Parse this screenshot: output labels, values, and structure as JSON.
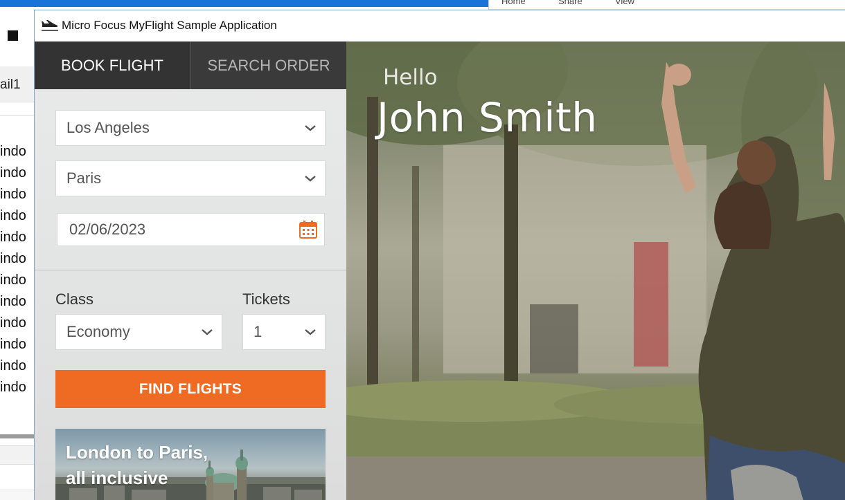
{
  "background": {
    "ribbon_tabs": [
      "Home",
      "Share",
      "View"
    ],
    "sidebar_folder": "ail1",
    "list_items": [
      "indo",
      "indo",
      "indo",
      "indo",
      "indo",
      "indo",
      "indo",
      "indo",
      "indo",
      "indo",
      "indo",
      "indo"
    ]
  },
  "window": {
    "title": "Micro Focus MyFlight Sample Application",
    "icon": "airplane-icon"
  },
  "tabs": {
    "book": "BOOK FLIGHT",
    "search": "SEARCH ORDER"
  },
  "form": {
    "from": "Los Angeles",
    "to": "Paris",
    "date": "02/06/2023",
    "class_label": "Class",
    "class_value": "Economy",
    "tickets_label": "Tickets",
    "tickets_value": "1",
    "find_button": "FIND FLIGHTS"
  },
  "promo": {
    "line1": "London to Paris,",
    "line2": "all inclusive"
  },
  "greeting": {
    "hello": "Hello",
    "name": "John Smith"
  },
  "colors": {
    "accent": "#ef6b24",
    "tab_bar": "#3a3a3a",
    "active_tab": "#333333"
  }
}
